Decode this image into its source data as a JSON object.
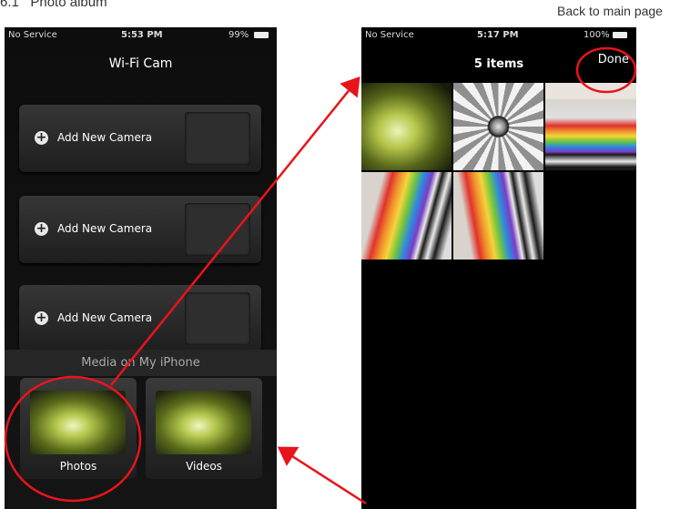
{
  "document": {
    "heading": "6.1   Photo album",
    "note": "Back to main page"
  },
  "left_phone": {
    "status": {
      "carrier": "No Service",
      "time": "5:53 PM",
      "battery": "99%"
    },
    "title": "Wi-Fi Cam",
    "cameras": [
      {
        "label": "Add New Camera"
      },
      {
        "label": "Add New Camera"
      },
      {
        "label": "Add New Camera"
      }
    ],
    "media_header": "Media on My iPhone",
    "photos_label": "Photos",
    "videos_label": "Videos"
  },
  "right_phone": {
    "status": {
      "carrier": "No Service",
      "time": "5:17 PM",
      "battery": "100%"
    },
    "title": "5 items",
    "done_label": "Done"
  },
  "annotations": {
    "color": "#e8141c"
  }
}
